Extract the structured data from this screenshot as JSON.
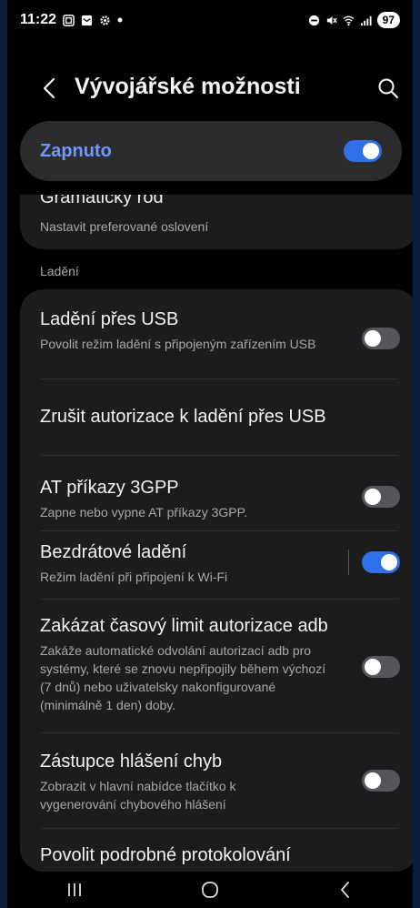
{
  "status_bar": {
    "time": "11:22",
    "battery": "97",
    "left_icons": [
      "screenshot-icon",
      "message-icon",
      "settings-icon",
      "dot-icon"
    ],
    "right_icons": [
      "dnd-icon",
      "mute-icon",
      "wifi-icon",
      "signal-icon"
    ]
  },
  "header": {
    "title": "Vývojářské možnosti"
  },
  "master_switch": {
    "label": "Zapnuto",
    "state": "on"
  },
  "partial_item": {
    "title": "Gramatický rod",
    "subtitle": "Nastavit preferované oslovení"
  },
  "section": {
    "label": "Ladění"
  },
  "items": [
    {
      "title": "Ladění přes USB",
      "subtitle": "Povolit režim ladění s připojeným zařízením USB",
      "toggle": "off"
    },
    {
      "title": "Zrušit autorizace k ladění přes USB",
      "subtitle": "",
      "toggle": "none"
    },
    {
      "title": "AT příkazy 3GPP",
      "subtitle": "Zapne nebo vypne AT příkazy 3GPP.",
      "toggle": "off"
    },
    {
      "title": "Bezdrátové ladění",
      "subtitle": "Režim ladění při připojení k Wi-Fi",
      "toggle": "on"
    },
    {
      "title": "Zakázat časový limit autorizace adb",
      "subtitle": "Zakáže automatické odvolání autorizací adb pro systémy, které se znovu nepřipojily během výchozí (7 dnů) nebo uživatelsky nakonfigurované (minimálně 1 den) doby.",
      "toggle": "off"
    },
    {
      "title": "Zástupce hlášení chyb",
      "subtitle": "Zobrazit v hlavní nabídce tlačítko k vygenerování chybového hlášení",
      "toggle": "off"
    },
    {
      "title": "Povolit podrobné protokolování",
      "subtitle": "",
      "toggle": "none"
    }
  ],
  "nav": {
    "buttons": [
      "recents-icon",
      "home-icon",
      "back-icon"
    ]
  },
  "colors": {
    "accent": "#6d98ff",
    "toggle_on": "#2f70e8",
    "card": "#1c1c1e"
  }
}
